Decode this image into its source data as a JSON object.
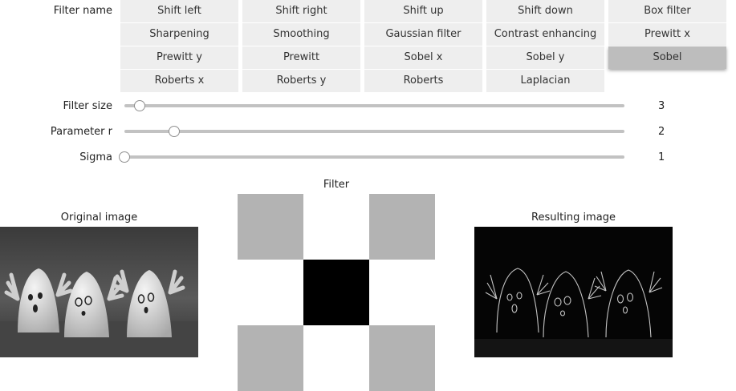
{
  "filter_name_label": "Filter name",
  "filters": [
    {
      "label": "Shift left",
      "active": false
    },
    {
      "label": "Shift right",
      "active": false
    },
    {
      "label": "Shift up",
      "active": false
    },
    {
      "label": "Shift down",
      "active": false
    },
    {
      "label": "Box filter",
      "active": false
    },
    {
      "label": "Sharpening",
      "active": false
    },
    {
      "label": "Smoothing",
      "active": false
    },
    {
      "label": "Gaussian filter",
      "active": false
    },
    {
      "label": "Contrast enhancing",
      "active": false
    },
    {
      "label": "Prewitt x",
      "active": false
    },
    {
      "label": "Prewitt y",
      "active": false
    },
    {
      "label": "Prewitt",
      "active": false
    },
    {
      "label": "Sobel x",
      "active": false
    },
    {
      "label": "Sobel y",
      "active": false
    },
    {
      "label": "Sobel",
      "active": true
    },
    {
      "label": "Roberts x",
      "active": false
    },
    {
      "label": "Roberts y",
      "active": false
    },
    {
      "label": "Roberts",
      "active": false
    },
    {
      "label": "Laplacian",
      "active": false
    }
  ],
  "sliders": {
    "filter_size": {
      "label": "Filter size",
      "value": "3",
      "level": 0.03
    },
    "parameter_r": {
      "label": "Parameter r",
      "value": "2",
      "level": 0.1
    },
    "sigma": {
      "label": "Sigma",
      "value": "1",
      "level": 0.0
    }
  },
  "panels": {
    "original_title": "Original image",
    "filter_title": "Filter",
    "result_title": "Resulting image"
  },
  "kernel_grid": [
    [
      "#b3b3b3",
      "#ffffff",
      "#b3b3b3"
    ],
    [
      "#ffffff",
      "#000000",
      "#ffffff"
    ],
    [
      "#b3b3b3",
      "#ffffff",
      "#b3b3b3"
    ]
  ],
  "colors": {
    "button_bg": "#eeeeee",
    "button_active_bg": "#bdbdbd",
    "slider_track": "#c2c2c2"
  }
}
